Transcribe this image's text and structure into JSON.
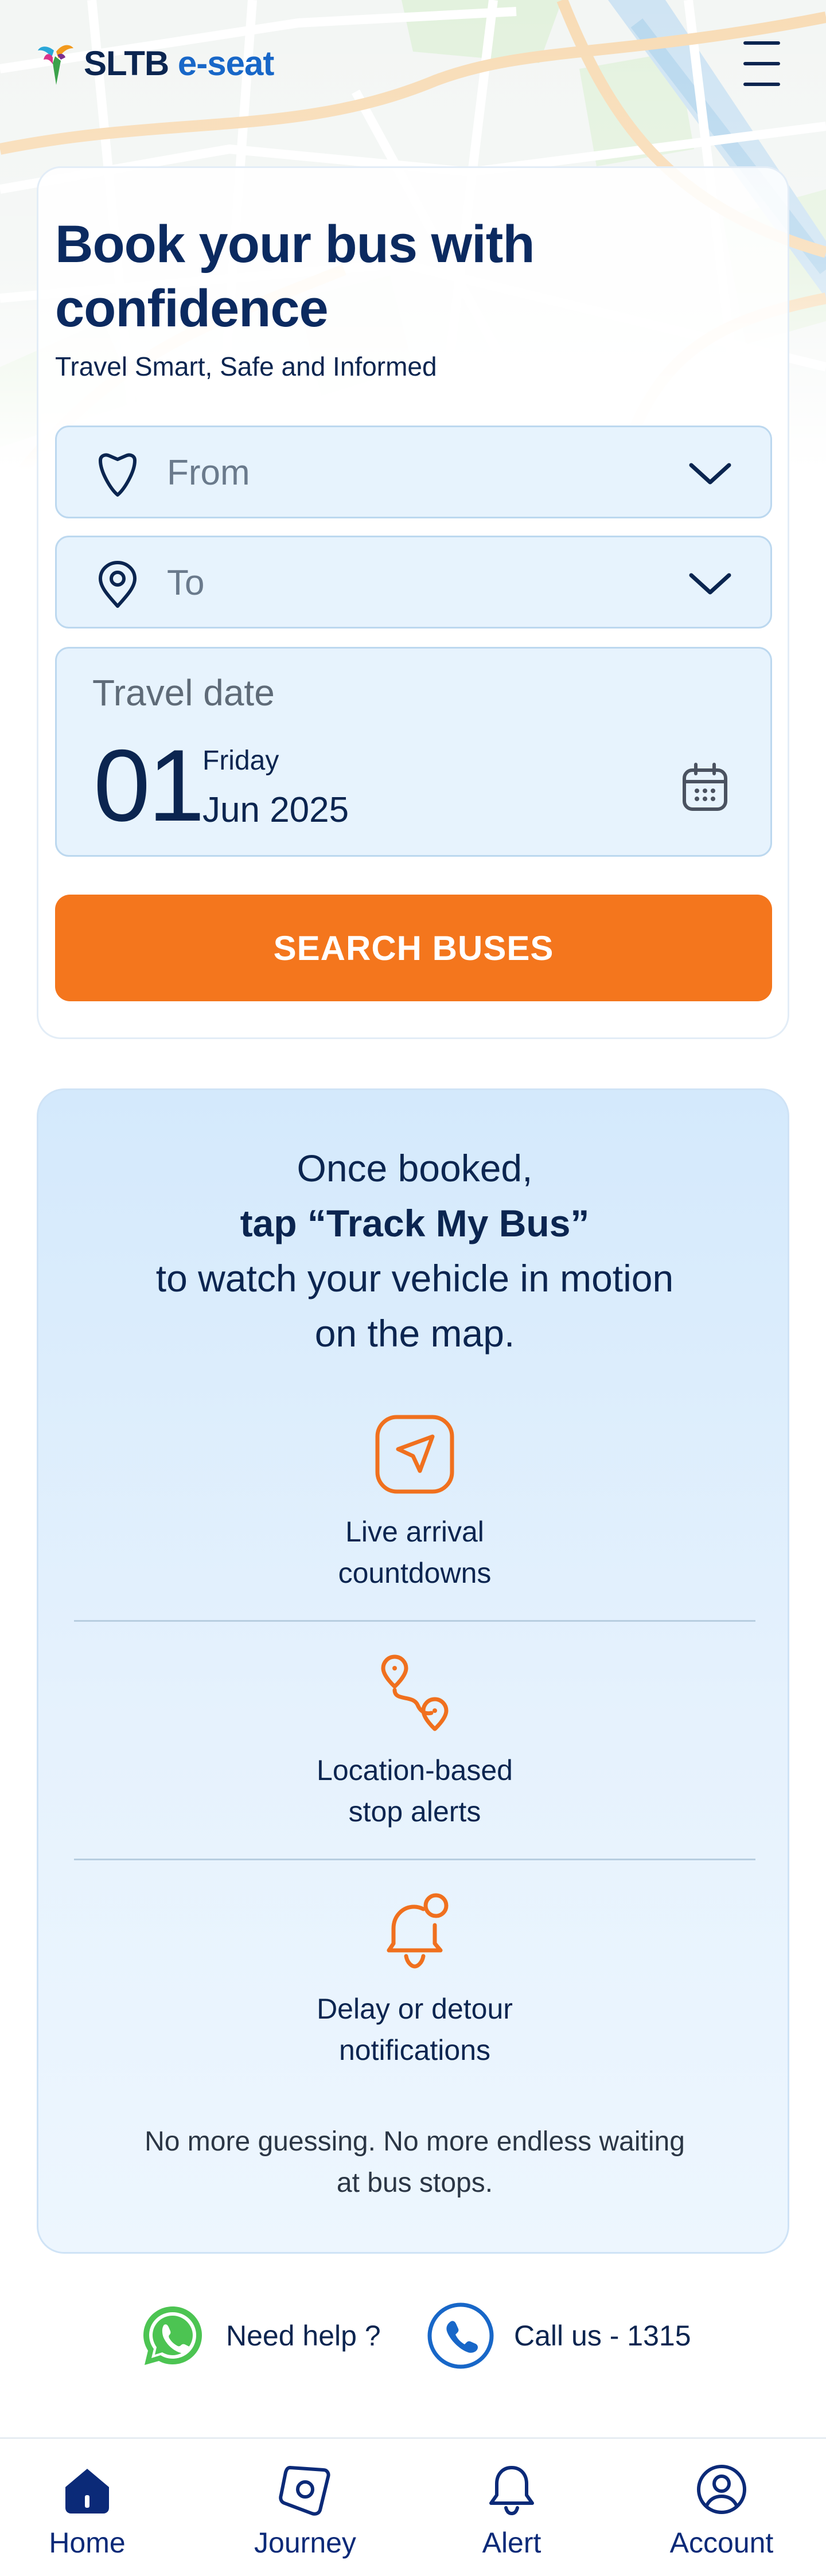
{
  "header": {
    "brand_primary": "SLTB",
    "brand_accent": "e-seat",
    "menu_icon": "hamburger-menu-icon"
  },
  "booking": {
    "headline": "Book your bus with confidence",
    "subline": "Travel Smart, Safe and Informed",
    "from_placeholder": "From",
    "to_placeholder": "To",
    "date_label": "Travel date",
    "date_day": "01",
    "date_weekday": "Friday",
    "date_month_year": "Jun 2025",
    "search_label": "SEARCH BUSES"
  },
  "tracking": {
    "intro_line1": "Once booked,",
    "intro_strong": "tap “Track My Bus”",
    "intro_line3": "to watch your vehicle in motion",
    "intro_line4": "on the map.",
    "features": [
      {
        "line1": "Live arrival",
        "line2": "countdowns",
        "icon": "navigation-arrow-icon"
      },
      {
        "line1": "Location-based",
        "line2": "stop alerts",
        "icon": "route-pins-icon"
      },
      {
        "line1": "Delay or detour",
        "line2": "notifications",
        "icon": "bell-notification-icon"
      }
    ],
    "footer_line1": "No more guessing. No more endless waiting",
    "footer_line2": "at bus stops."
  },
  "help": {
    "whatsapp_label": "Need help ?",
    "call_label": "Call us - 1315"
  },
  "nav": {
    "items": [
      {
        "label": "Home",
        "icon": "home-icon",
        "active": true
      },
      {
        "label": "Journey",
        "icon": "compass-icon",
        "active": false
      },
      {
        "label": "Alert",
        "icon": "bell-icon",
        "active": false
      },
      {
        "label": "Account",
        "icon": "user-circle-icon",
        "active": false
      }
    ]
  },
  "colors": {
    "brand_navy": "#0b2550",
    "accent_blue": "#1867c8",
    "cta_orange": "#f4761d",
    "field_bg": "#e7f3fd",
    "whatsapp_green": "#4cc452",
    "call_blue": "#1867c8"
  }
}
